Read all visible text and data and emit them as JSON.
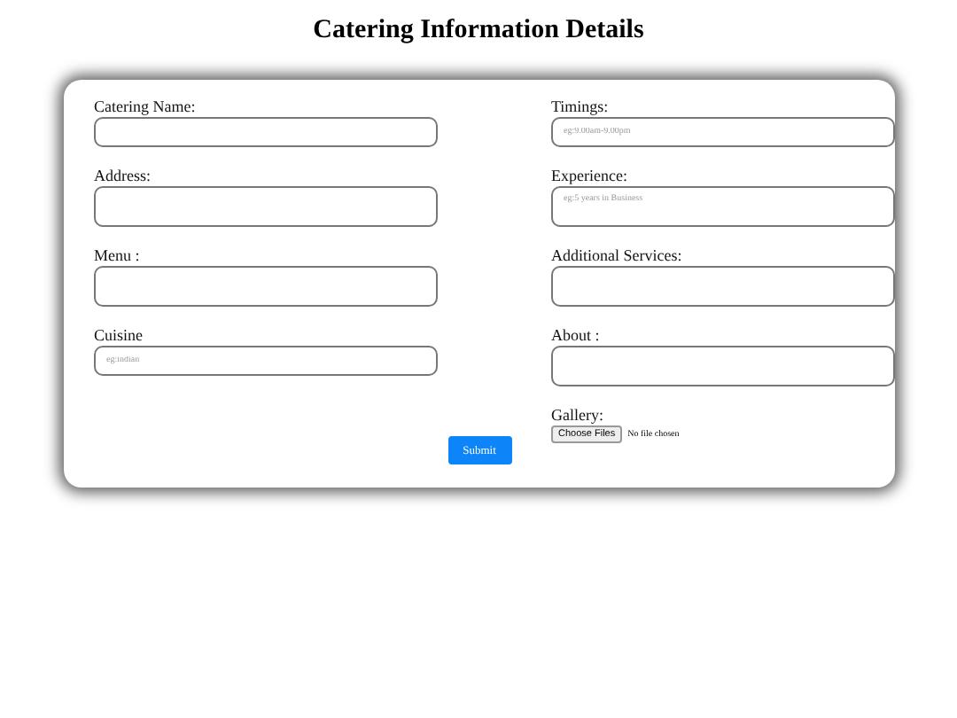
{
  "title": "Catering Information Details",
  "columns": [
    [
      {
        "kind": "input",
        "label": "Catering Name:"
      },
      {
        "kind": "textarea",
        "label": "Address:"
      },
      {
        "kind": "textarea",
        "label": "Menu :"
      },
      {
        "kind": "input",
        "label": "Cuisine",
        "placeholder": "eg:indian"
      }
    ],
    [
      {
        "kind": "input",
        "label": "Timings:",
        "placeholder": "eg:9.00am-9.00pm"
      },
      {
        "kind": "textarea",
        "label": "Experience:",
        "placeholder": "eg:5 years in Business"
      },
      {
        "kind": "textarea",
        "label": "Additional Services:"
      },
      {
        "kind": "textarea",
        "label": "About :"
      },
      {
        "kind": "file",
        "label": "Gallery:",
        "button": "Choose Files",
        "status": "No file chosen"
      }
    ]
  ],
  "submit": "Submit"
}
